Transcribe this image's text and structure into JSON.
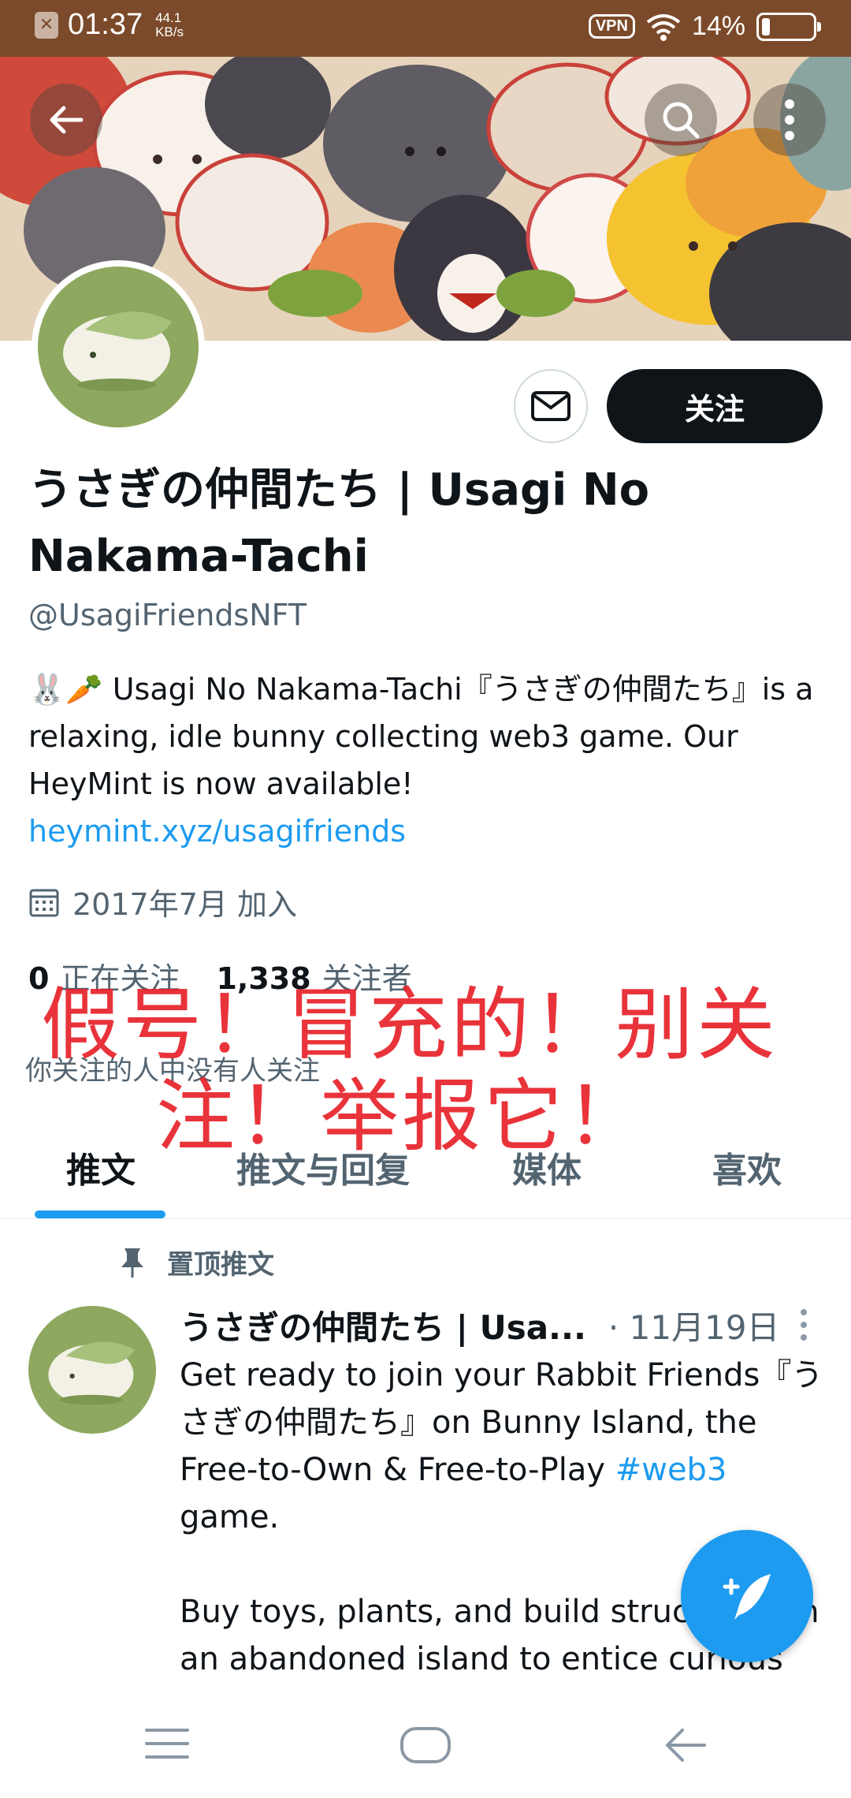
{
  "status_bar": {
    "time": "01:37",
    "net_speed_value": "44.1",
    "net_speed_unit": "KB/s",
    "vpn": "VPN",
    "battery_percent": "14%",
    "battery_level": 0.14
  },
  "profile": {
    "name": "うさぎの仲間たち | Usagi No Nakama-Tachi",
    "handle": "@UsagiFriendsNFT",
    "bio_emoji": "🐰🥕",
    "bio": " Usagi No Nakama-Tachi『うさぎの仲間たち』is a relaxing, idle bunny collecting web3 game.  Our HeyMint is now available!",
    "link": "heymint.xyz/usagifriends",
    "joined": "2017年7月 加入",
    "following_count": "0",
    "following_label": "正在关注",
    "followers_count": "1,338",
    "followers_label": "关注者",
    "follow_context": "你关注的人中没有人关注",
    "follow_button": "关注"
  },
  "overlay": {
    "line1": "假号！冒充的！别关",
    "line2": "注！举报它！",
    "color": "#e8222a"
  },
  "tabs": [
    {
      "label": "推文",
      "active": true
    },
    {
      "label": "推文与回复",
      "active": false
    },
    {
      "label": "媒体",
      "active": false
    },
    {
      "label": "喜欢",
      "active": false
    }
  ],
  "pinned_label": "置顶推文",
  "tweet": {
    "author": "うさぎの仲間たち | Usa...",
    "date": "· 11月19日",
    "text_part1": "Get ready to join your Rabbit Friends『うさぎの仲間たち』on Bunny Island, the Free-to-Own & Free-to-Play ",
    "hashtag": "#web3",
    "text_part2": " game.\n\nBuy toys, plants, and build structures on an abandoned island to entice curious"
  },
  "icons": {
    "back": "arrow-left-icon",
    "search": "search-icon",
    "more": "more-vertical-icon",
    "message": "envelope-icon",
    "calendar": "calendar-icon",
    "pin": "pin-icon",
    "compose": "compose-feather-icon",
    "nav_menu": "menu-icon",
    "nav_home": "home-icon",
    "nav_back": "nav-back-icon"
  },
  "colors": {
    "accent": "#1d9bf0",
    "status_bar": "#7b4a2a",
    "follow_button": "#0f1419",
    "overlay_text": "#e8222a"
  }
}
